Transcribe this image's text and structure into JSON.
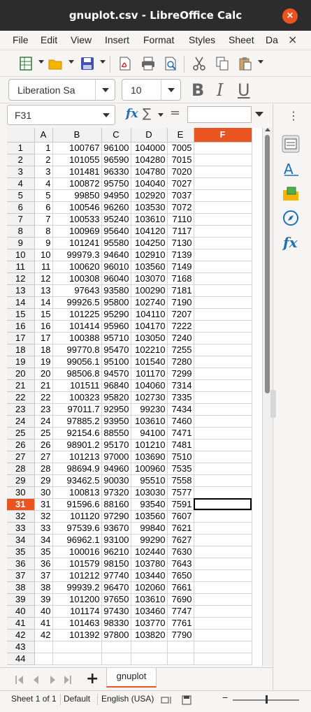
{
  "window": {
    "title": "gnuplot.csv - LibreOffice Calc",
    "close_glyph": "×"
  },
  "menubar": {
    "items": [
      "File",
      "Edit",
      "View",
      "Insert",
      "Format",
      "Styles",
      "Sheet",
      "Da"
    ],
    "close_glyph": "×"
  },
  "formatting": {
    "font_name": "Liberation Sa",
    "font_size": "10",
    "bold": "B",
    "italic": "I",
    "underline": "U"
  },
  "formula_bar": {
    "name_box": "F31",
    "fx": "fx",
    "sigma": "∑",
    "equals": "="
  },
  "grid": {
    "col_headers": [
      "A",
      "B",
      "C",
      "D",
      "E",
      "F"
    ],
    "selected_col": "F",
    "selected_row": 31,
    "rows": [
      [
        "1",
        "100767",
        "96100",
        "104000",
        "7005"
      ],
      [
        "2",
        "101055",
        "96590",
        "104280",
        "7015"
      ],
      [
        "3",
        "101481",
        "96330",
        "104780",
        "7020"
      ],
      [
        "4",
        "100872",
        "95750",
        "104040",
        "7027"
      ],
      [
        "5",
        "99850",
        "94950",
        "102920",
        "7037"
      ],
      [
        "6",
        "100546",
        "96260",
        "103530",
        "7072"
      ],
      [
        "7",
        "100533",
        "95240",
        "103610",
        "7110"
      ],
      [
        "8",
        "100969",
        "95640",
        "104120",
        "7117"
      ],
      [
        "9",
        "101241",
        "95580",
        "104250",
        "7130"
      ],
      [
        "10",
        "99979.3",
        "94640",
        "102910",
        "7139"
      ],
      [
        "11",
        "100620",
        "96010",
        "103560",
        "7149"
      ],
      [
        "12",
        "100308",
        "96040",
        "103070",
        "7168"
      ],
      [
        "13",
        "97643",
        "93580",
        "100290",
        "7181"
      ],
      [
        "14",
        "99926.5",
        "95800",
        "102740",
        "7190"
      ],
      [
        "15",
        "101225",
        "95290",
        "104110",
        "7207"
      ],
      [
        "16",
        "101414",
        "95960",
        "104170",
        "7222"
      ],
      [
        "17",
        "100388",
        "95710",
        "103050",
        "7240"
      ],
      [
        "18",
        "99770.8",
        "95470",
        "102210",
        "7255"
      ],
      [
        "19",
        "99056.1",
        "95100",
        "101540",
        "7280"
      ],
      [
        "20",
        "98506.8",
        "94570",
        "101170",
        "7299"
      ],
      [
        "21",
        "101511",
        "96840",
        "104060",
        "7314"
      ],
      [
        "22",
        "100323",
        "95820",
        "102730",
        "7335"
      ],
      [
        "23",
        "97011.7",
        "92950",
        "99230",
        "7434"
      ],
      [
        "24",
        "97885.2",
        "93950",
        "103610",
        "7460"
      ],
      [
        "25",
        "92154.6",
        "88550",
        "94100",
        "7471"
      ],
      [
        "26",
        "98901.2",
        "95170",
        "101210",
        "7481"
      ],
      [
        "27",
        "101213",
        "97000",
        "103690",
        "7510"
      ],
      [
        "28",
        "98694.9",
        "94960",
        "100960",
        "7535"
      ],
      [
        "29",
        "93462.5",
        "90030",
        "95510",
        "7558"
      ],
      [
        "30",
        "100813",
        "97320",
        "103030",
        "7577"
      ],
      [
        "31",
        "91596.6",
        "88160",
        "93540",
        "7591"
      ],
      [
        "32",
        "101120",
        "97290",
        "103560",
        "7607"
      ],
      [
        "33",
        "97539.6",
        "93670",
        "99840",
        "7621"
      ],
      [
        "34",
        "96962.1",
        "93100",
        "99290",
        "7627"
      ],
      [
        "35",
        "100016",
        "96210",
        "102440",
        "7630"
      ],
      [
        "36",
        "101579",
        "98150",
        "103780",
        "7643"
      ],
      [
        "37",
        "101212",
        "97740",
        "103440",
        "7650"
      ],
      [
        "38",
        "99939.2",
        "96470",
        "102060",
        "7661"
      ],
      [
        "39",
        "101200",
        "97650",
        "103610",
        "7690"
      ],
      [
        "40",
        "101174",
        "97430",
        "103460",
        "7747"
      ],
      [
        "41",
        "101463",
        "98330",
        "103770",
        "7761"
      ],
      [
        "42",
        "101392",
        "97800",
        "103820",
        "7790"
      ],
      [
        "",
        "",
        "",
        "",
        ""
      ],
      [
        "",
        "",
        "",
        "",
        ""
      ]
    ]
  },
  "sheet_tabs": {
    "add_glyph": "+",
    "tabs": [
      "gnuplot"
    ]
  },
  "statusbar": {
    "sheet": "Sheet 1 of 1",
    "style": "Default",
    "language": "English (USA)"
  },
  "colors": {
    "accent": "#e95420",
    "titlebar": "#2c2c2c"
  }
}
